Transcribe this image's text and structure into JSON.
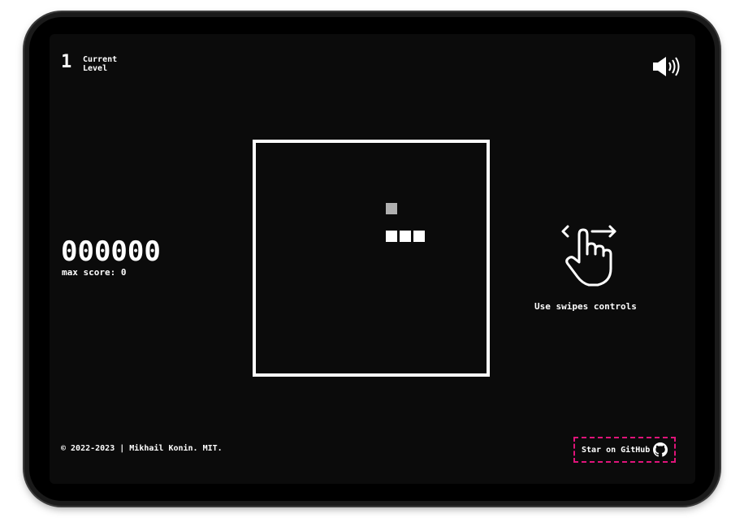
{
  "level": {
    "number": "1",
    "label": "Current Level"
  },
  "sound": {
    "icon": "speaker-on-icon"
  },
  "score": {
    "value": "000000",
    "max_score_text": "max score: 0"
  },
  "board": {
    "cells": [
      {
        "col": 6,
        "row": 2,
        "color": "#b0b0b0",
        "kind": "ghost"
      },
      {
        "col": 6,
        "row": 4,
        "color": "#ffffff",
        "kind": "block"
      },
      {
        "col": 7,
        "row": 4,
        "color": "#ffffff",
        "kind": "block"
      },
      {
        "col": 8,
        "row": 4,
        "color": "#ffffff",
        "kind": "block"
      }
    ]
  },
  "hint": {
    "icon": "swipe-hand-icon",
    "text": "Use swipes controls"
  },
  "footer": {
    "copyright": "© 2022-2023 | Mikhail Konin. MIT.",
    "github_label": "Star on GitHub",
    "github_icon": "github-icon",
    "accent_color": "#e0147a"
  }
}
